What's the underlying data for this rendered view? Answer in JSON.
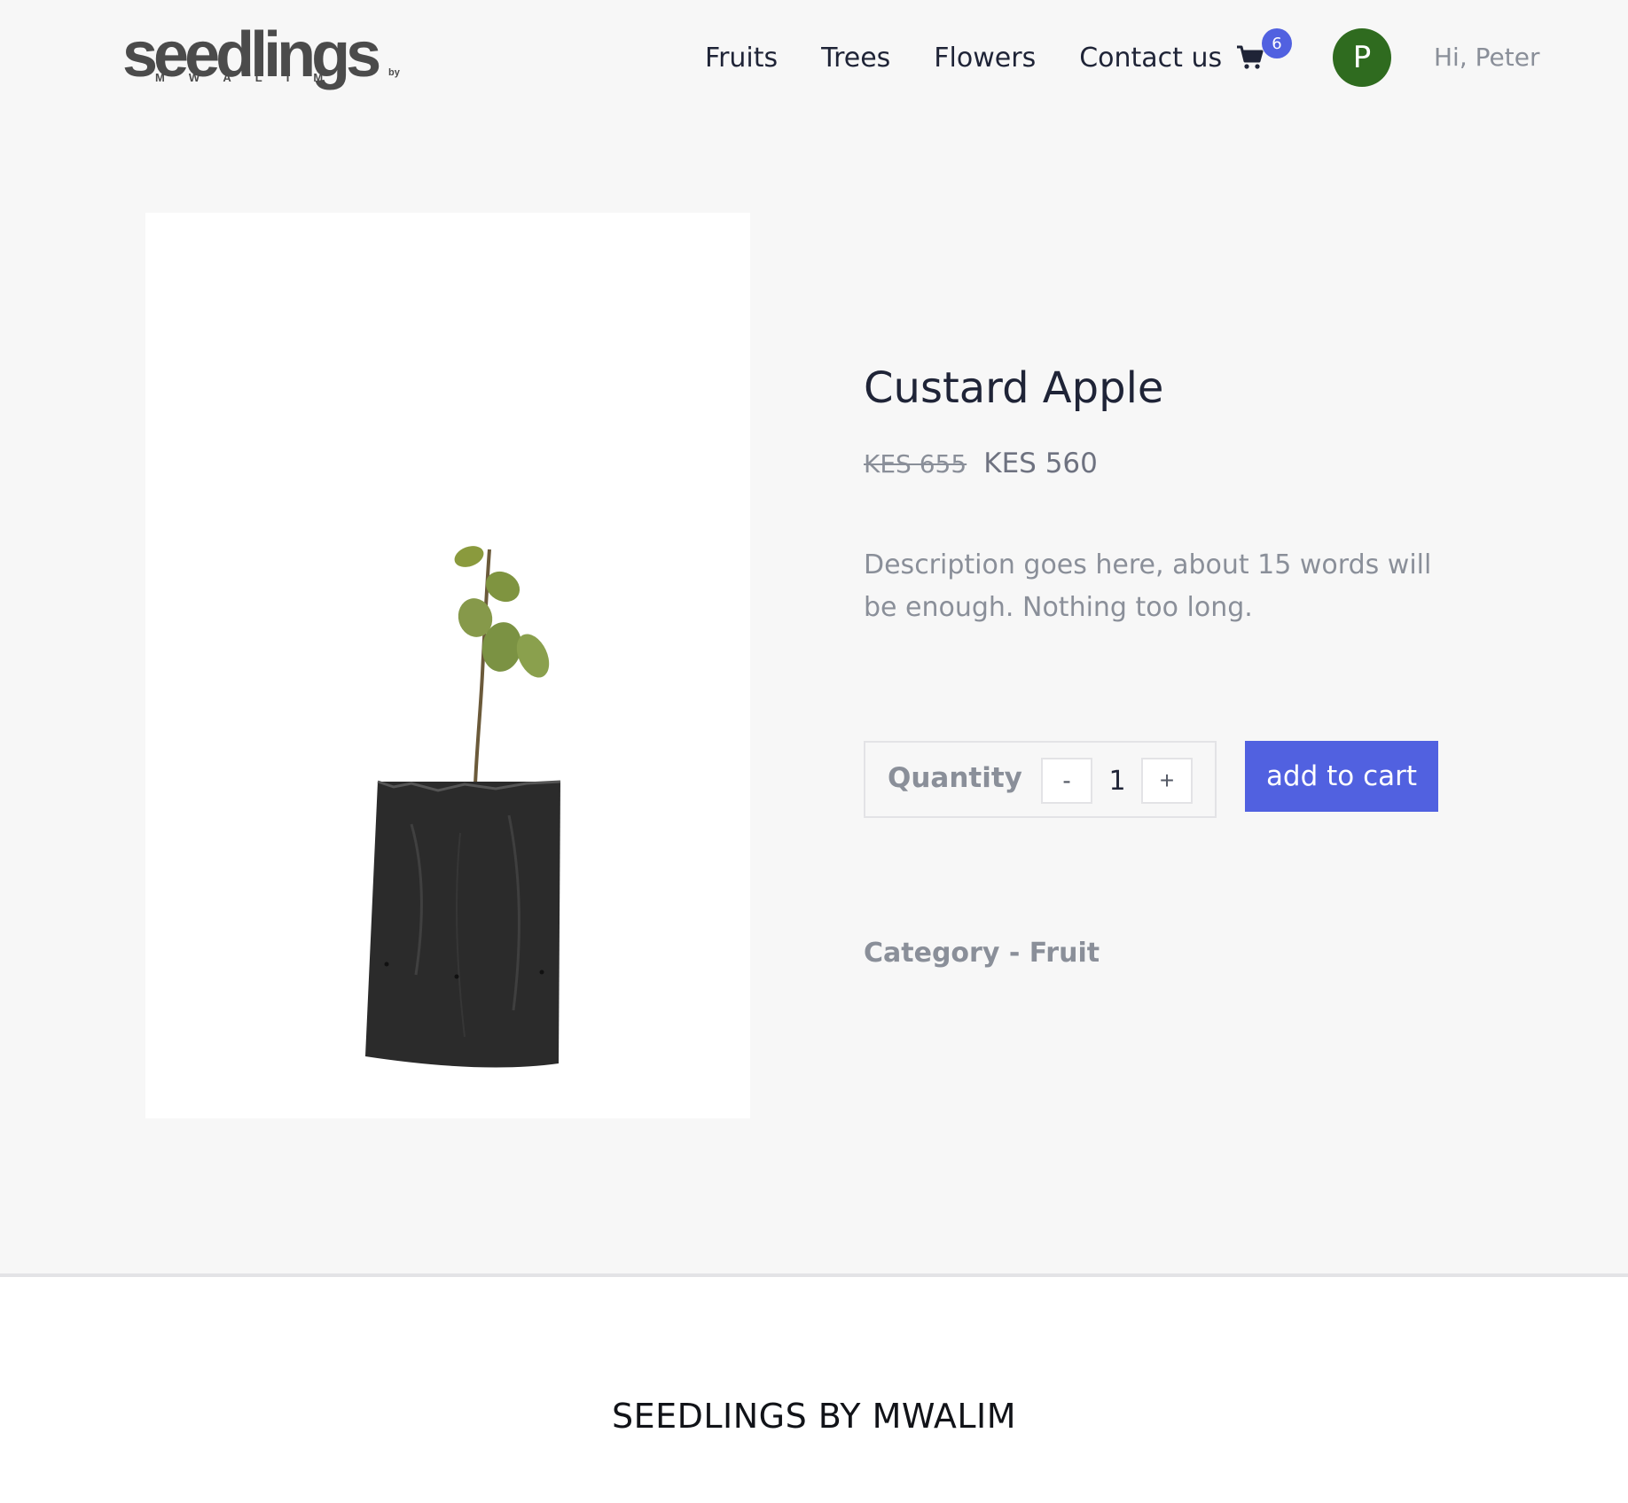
{
  "brand": {
    "logo_word": "seedlings",
    "logo_by": "by",
    "logo_sub": "MWALIM"
  },
  "nav": {
    "items": [
      {
        "label": "Fruits"
      },
      {
        "label": "Trees"
      },
      {
        "label": "Flowers"
      },
      {
        "label": "Contact us"
      }
    ],
    "cart_icon": "shopping-cart-icon",
    "cart_count": "6",
    "avatar_initial": "P",
    "greeting": "Hi, Peter"
  },
  "product": {
    "title": "Custard Apple",
    "old_price": "KES 655",
    "price": "KES 560",
    "description": "Description goes here, about 15 words will be enough. Nothing too long.",
    "quantity_label": "Quantity",
    "quantity": "1",
    "minus_label": "-",
    "plus_label": "+",
    "add_to_cart_label": "add to cart",
    "category": "Category - Fruit",
    "image": "seedling-in-black-bag"
  },
  "footer": {
    "brand": "SEEDLINGS BY MWALIM"
  },
  "colors": {
    "accent": "#5161e0",
    "avatar": "#2f6b1f",
    "background": "#f7f7f7"
  }
}
